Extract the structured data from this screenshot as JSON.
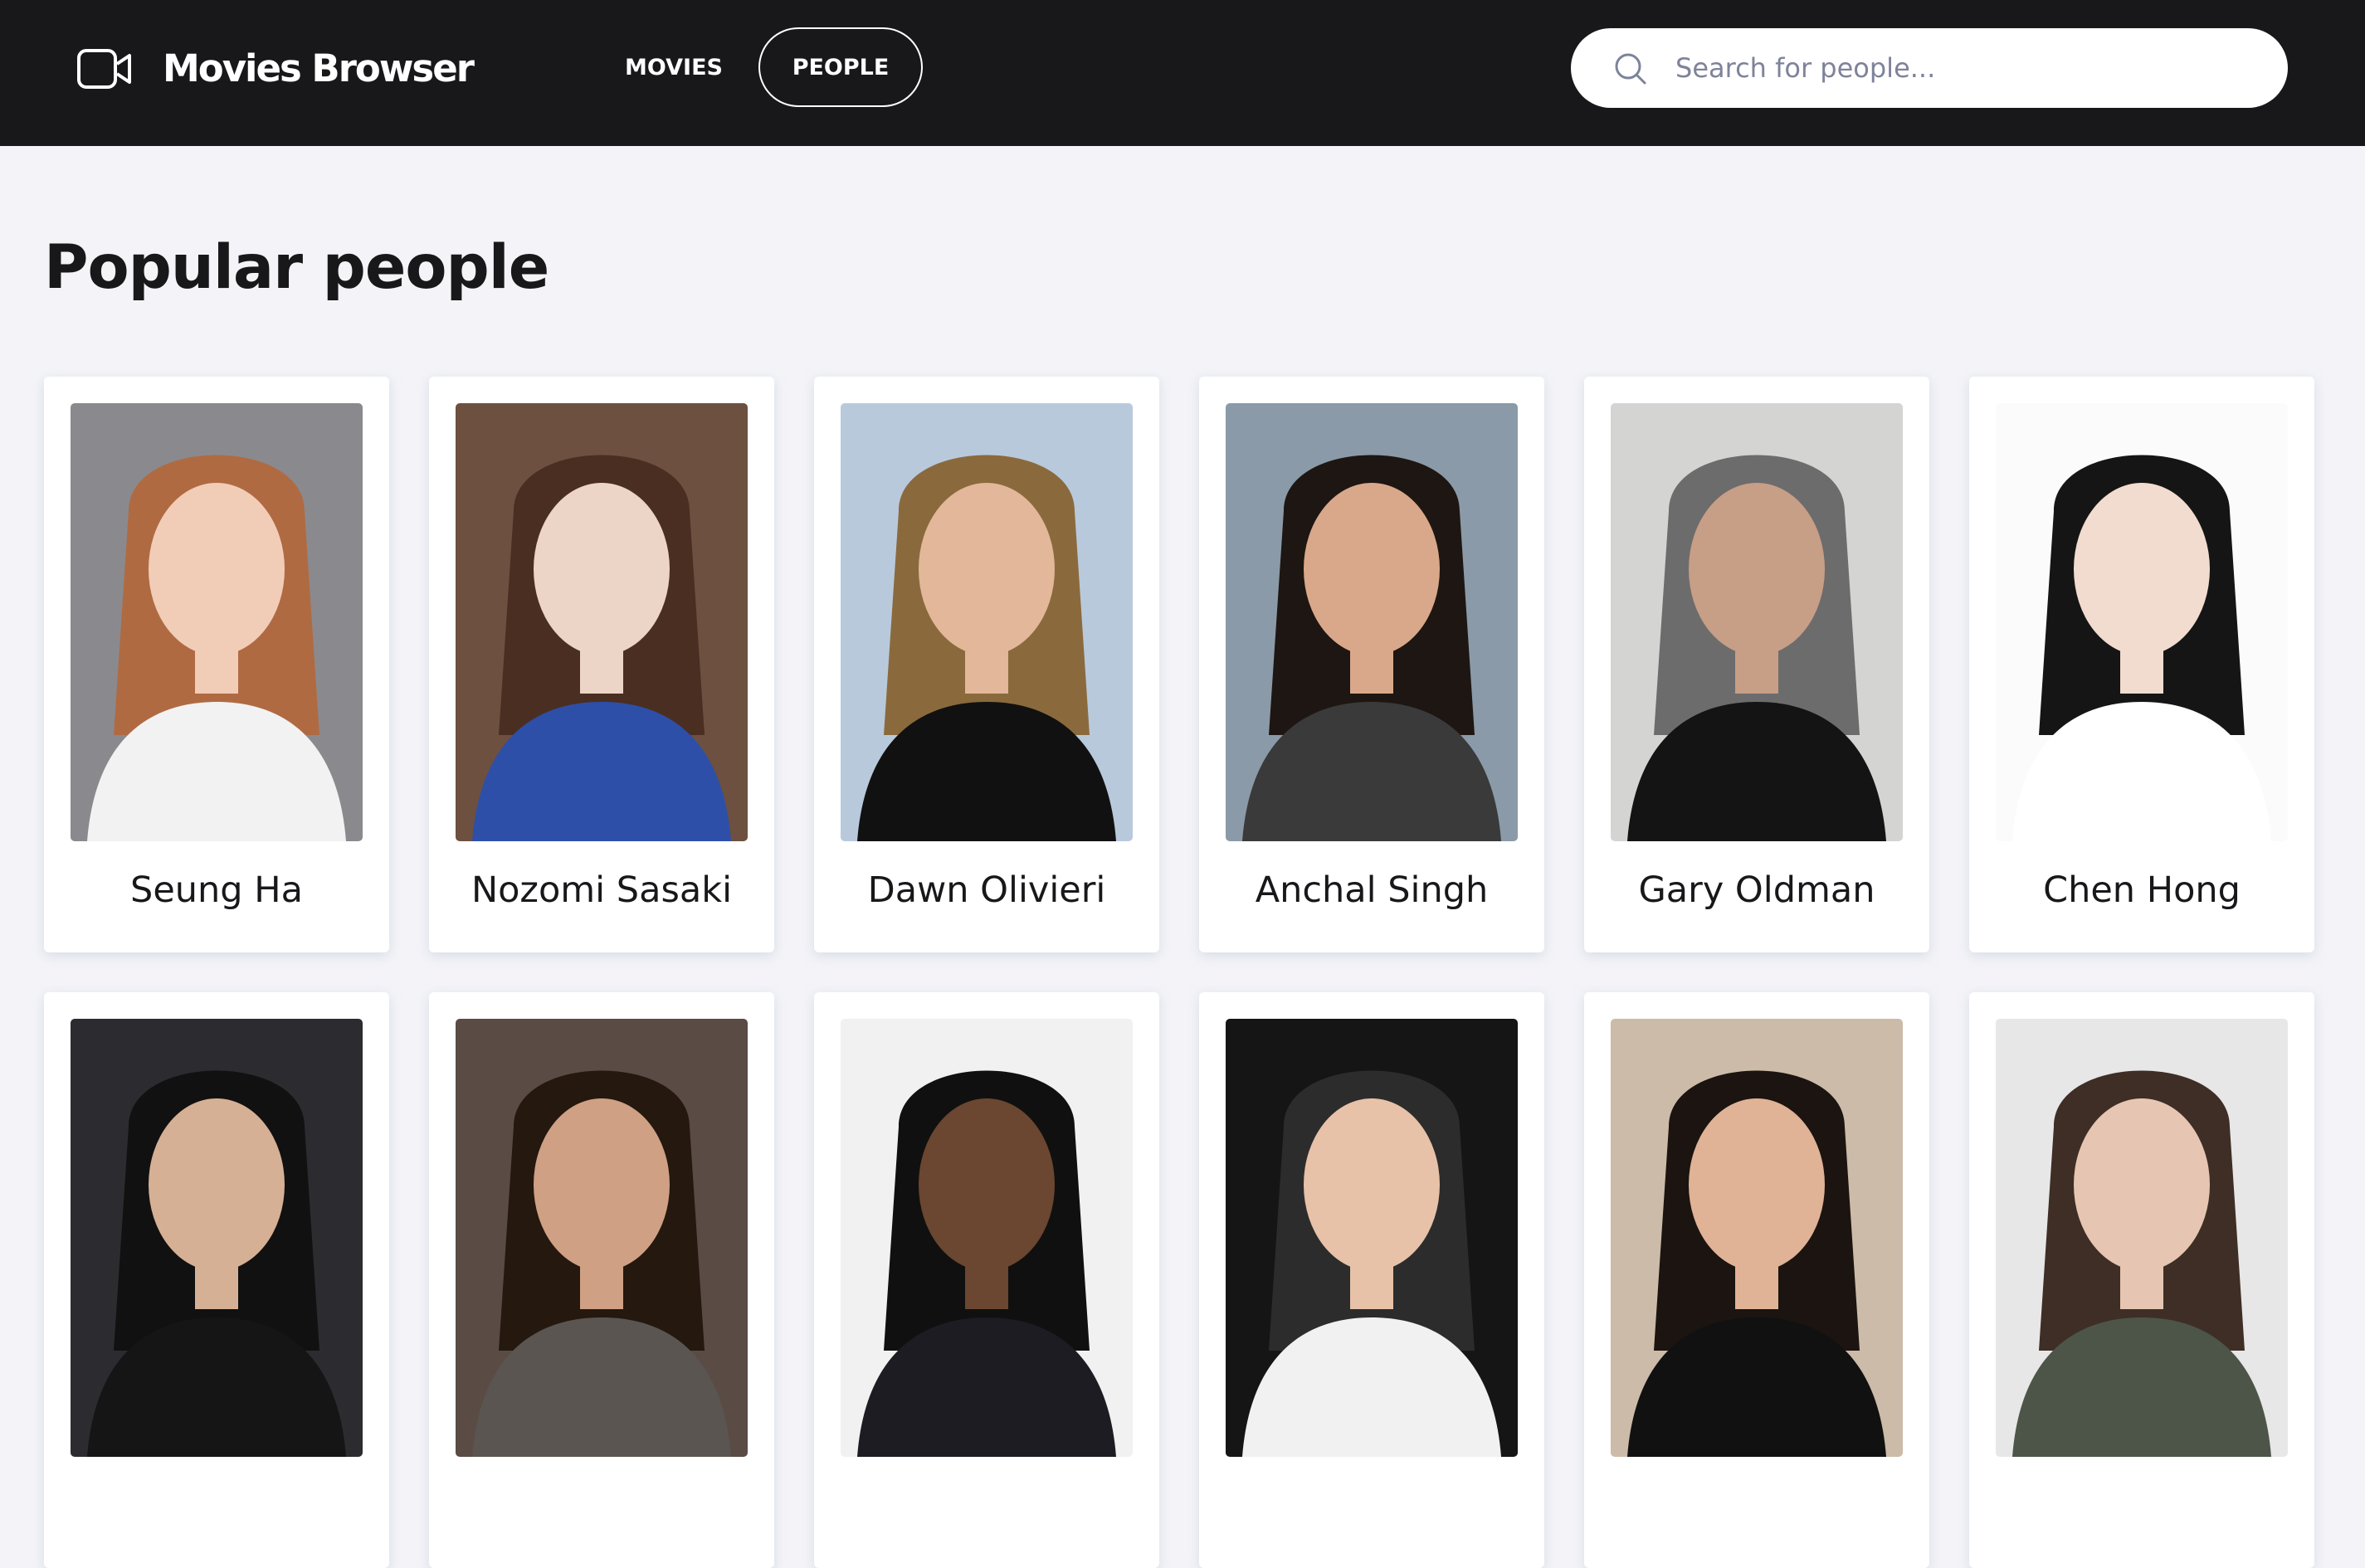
{
  "header": {
    "app_title": "Movies Browser",
    "logo_icon": "video-camera-icon",
    "nav": [
      {
        "label": "MOVIES",
        "active": false
      },
      {
        "label": "PEOPLE",
        "active": true
      }
    ],
    "search": {
      "placeholder": "Search for people...",
      "value": "",
      "icon": "search-icon"
    }
  },
  "main": {
    "title": "Popular people",
    "people": [
      {
        "name": "Seung Ha",
        "bg": "#8a8a8e",
        "hair": "#b06a42",
        "skin": "#f1cdb8",
        "cloth": "#f2f2f2"
      },
      {
        "name": "Nozomi Sasaki",
        "bg": "#6d5040",
        "hair": "#4a2e22",
        "skin": "#ecd4c6",
        "cloth": "#2d4fa8"
      },
      {
        "name": "Dawn Olivieri",
        "bg": "#b9c9dc",
        "hair": "#8a6a3c",
        "skin": "#e2b79a",
        "cloth": "#111111"
      },
      {
        "name": "Anchal Singh",
        "bg": "#8a9aa8",
        "hair": "#1e1612",
        "skin": "#d9a88a",
        "cloth": "#3a3a3a"
      },
      {
        "name": "Gary Oldman",
        "bg": "#d4d4d2",
        "hair": "#6c6c6c",
        "skin": "#c79e86",
        "cloth": "#141414"
      },
      {
        "name": "Chen Hong",
        "bg": "#fbfbfb",
        "hair": "#151515",
        "skin": "#f2dccf",
        "cloth": "#ffffff"
      },
      {
        "name": "",
        "bg": "#2c2c30",
        "hair": "#111111",
        "skin": "#d6b095",
        "cloth": "#151515"
      },
      {
        "name": "",
        "bg": "#5a4b45",
        "hair": "#24180f",
        "skin": "#cfa084",
        "cloth": "#5a5550"
      },
      {
        "name": "",
        "bg": "#f1f1f1",
        "hair": "#101010",
        "skin": "#6b4630",
        "cloth": "#1c1c22"
      },
      {
        "name": "",
        "bg": "#151515",
        "hair": "#2c2c2c",
        "skin": "#e7c2a8",
        "cloth": "#f1f1f1"
      },
      {
        "name": "",
        "bg": "#cbbba8",
        "hair": "#1b1410",
        "skin": "#e0b296",
        "cloth": "#111111"
      },
      {
        "name": "",
        "bg": "#e7e7e7",
        "hair": "#3e2e25",
        "skin": "#e6c6b2",
        "cloth": "#4d5548"
      }
    ]
  }
}
